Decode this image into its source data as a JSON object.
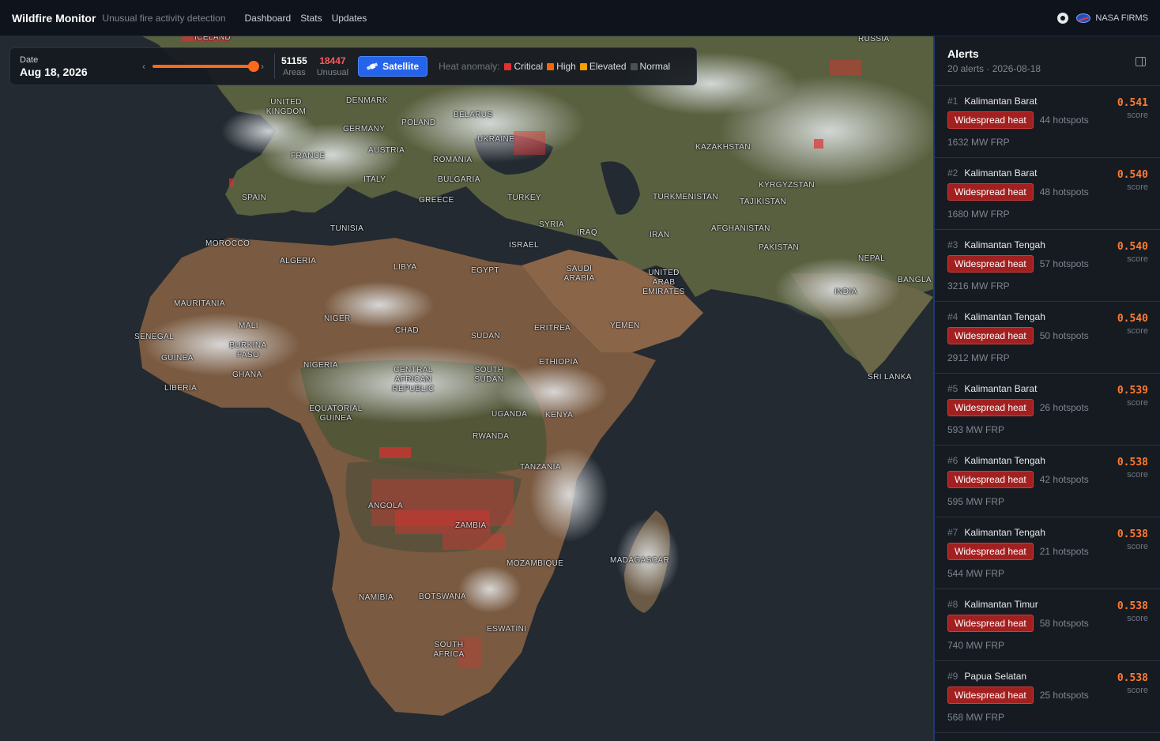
{
  "app": {
    "title": "Wildfire Monitor",
    "tagline": "Unusual fire activity detection",
    "nav": [
      "Dashboard",
      "Stats",
      "Updates"
    ],
    "source_label": "NASA FIRMS"
  },
  "controls": {
    "date_caption": "Date",
    "date_value": "Aug 18, 2026",
    "slider_position": 1.0,
    "prev_icon": "chevron-left-icon",
    "next_icon": "chevron-right-icon",
    "areas_value": "51155",
    "areas_label": "Areas",
    "unusual_value": "18447",
    "unusual_label": "Unusual",
    "satellite_label": "Satellite",
    "legend_title": "Heat anomaly:",
    "legend": [
      {
        "label": "Critical",
        "color": "#e03131"
      },
      {
        "label": "High",
        "color": "#f76707"
      },
      {
        "label": "Elevated",
        "color": "#f59f00"
      },
      {
        "label": "Normal",
        "color": "#495057"
      }
    ]
  },
  "map": {
    "labels": {
      "iceland": "ICELAND",
      "russia": "RUSSIA",
      "uk": "UNITED KINGDOM",
      "denmark": "DENMARK",
      "belarus": "BELARUS",
      "poland": "POLAND",
      "germany": "GERMANY",
      "ukraine": "UKRAINE",
      "kazakhstan": "KAZAKHSTAN",
      "austria": "AUSTRIA",
      "france": "FRANCE",
      "romania": "ROMANIA",
      "italy": "ITALY",
      "bulgaria": "BULGARIA",
      "spain": "SPAIN",
      "greece": "GREECE",
      "turkey": "TURKEY",
      "turkmenistan": "TURKMENISTAN",
      "kyrgyzstan": "KYRGYZSTAN",
      "tajikistan": "TAJIKISTAN",
      "tunisia": "TUNISIA",
      "syria": "SYRIA",
      "iraq": "IRAQ",
      "iran": "IRAN",
      "afghanistan": "AFGHANISTAN",
      "morocco": "MOROCCO",
      "israel": "ISRAEL",
      "pakistan": "PAKISTAN",
      "nepal": "NEPAL",
      "algeria": "ALGERIA",
      "libya": "LIBYA",
      "egypt": "EGYPT",
      "saudi": "SAUDI ARABIA",
      "uae": "UNITED ARAB EMIRATES",
      "bangladesh": "BANGLA",
      "india": "INDIA",
      "mauritania": "MAURITANIA",
      "niger": "NIGER",
      "mali": "MALI",
      "chad": "CHAD",
      "eritrea": "ERITREA",
      "yemen": "YEMEN",
      "senegal": "SENEGAL",
      "burkina": "BURKINA FASO",
      "sudan": "SUDAN",
      "guinea": "GUINEA",
      "nigeria": "NIGERIA",
      "ethiopia": "ETHIOPIA",
      "ghana": "GHANA",
      "car": "CENTRAL AFRICAN REPUBLIC",
      "south_sudan": "SOUTH SUDAN",
      "liberia": "LIBERIA",
      "srilanka": "SRI LANKA",
      "eq_guinea": "EQUATORIAL GUINEA",
      "uganda": "UGANDA",
      "kenya": "KENYA",
      "rwanda": "RWANDA",
      "tanzania": "TANZANIA",
      "angola": "ANGOLA",
      "zambia": "ZAMBIA",
      "madagascar": "MADAGASCAR",
      "mozambique": "MOZAMBIQUE",
      "namibia": "NAMIBIA",
      "botswana": "BOTSWANA",
      "eswatini": "ESWATINI",
      "south_africa": "SOUTH AFRICA"
    }
  },
  "alerts": {
    "title": "Alerts",
    "subtitle": "20 alerts · 2026-08-18",
    "score_label": "score",
    "items": [
      {
        "rank": "#1",
        "region": "Kalimantan Barat",
        "badge": "Widespread heat",
        "hotspots": "44 hotspots",
        "frp": "1632 MW FRP",
        "score": "0.541"
      },
      {
        "rank": "#2",
        "region": "Kalimantan Barat",
        "badge": "Widespread heat",
        "hotspots": "48 hotspots",
        "frp": "1680 MW FRP",
        "score": "0.540"
      },
      {
        "rank": "#3",
        "region": "Kalimantan Tengah",
        "badge": "Widespread heat",
        "hotspots": "57 hotspots",
        "frp": "3216 MW FRP",
        "score": "0.540"
      },
      {
        "rank": "#4",
        "region": "Kalimantan Tengah",
        "badge": "Widespread heat",
        "hotspots": "50 hotspots",
        "frp": "2912 MW FRP",
        "score": "0.540"
      },
      {
        "rank": "#5",
        "region": "Kalimantan Barat",
        "badge": "Widespread heat",
        "hotspots": "26 hotspots",
        "frp": "593 MW FRP",
        "score": "0.539"
      },
      {
        "rank": "#6",
        "region": "Kalimantan Tengah",
        "badge": "Widespread heat",
        "hotspots": "42 hotspots",
        "frp": "595 MW FRP",
        "score": "0.538"
      },
      {
        "rank": "#7",
        "region": "Kalimantan Tengah",
        "badge": "Widespread heat",
        "hotspots": "21 hotspots",
        "frp": "544 MW FRP",
        "score": "0.538"
      },
      {
        "rank": "#8",
        "region": "Kalimantan Timur",
        "badge": "Widespread heat",
        "hotspots": "58 hotspots",
        "frp": "740 MW FRP",
        "score": "0.538"
      },
      {
        "rank": "#9",
        "region": "Papua Selatan",
        "badge": "Widespread heat",
        "hotspots": "25 hotspots",
        "frp": "568 MW FRP",
        "score": "0.538"
      }
    ]
  }
}
